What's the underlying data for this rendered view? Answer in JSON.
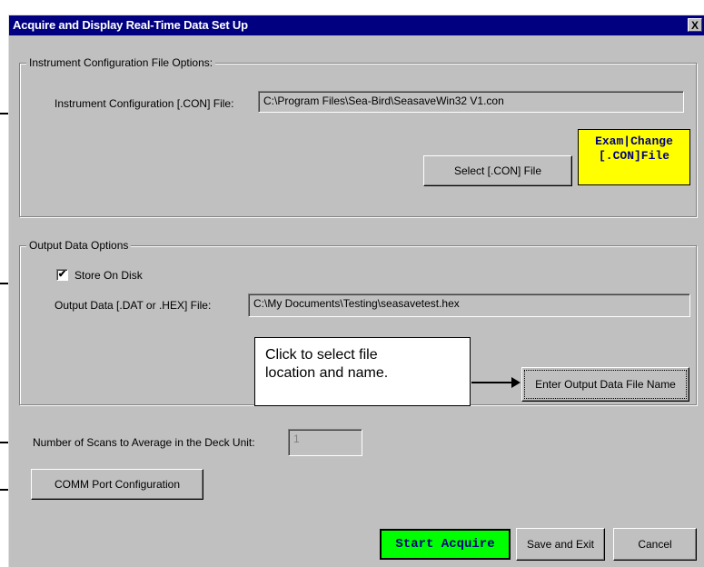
{
  "window": {
    "title": "Acquire and Display Real-Time Data Set Up",
    "close_glyph": "X"
  },
  "instrument_group": {
    "legend": "Instrument Configuration File Options:",
    "con_label": "Instrument Configuration [.CON] File:",
    "con_value": "C:\\Program Files\\Sea-Bird\\SeasaveWin32 V1.con",
    "select_button": "Select [.CON] File",
    "exam_line1": "Exam|Change",
    "exam_line2": "[.CON]File"
  },
  "output_group": {
    "legend": "Output Data Options",
    "store_on_disk_label": "Store On Disk",
    "store_on_disk_checked": true,
    "check_glyph": "✔",
    "output_label": "Output Data [.DAT or .HEX] File:",
    "output_value": "C:\\My Documents\\Testing\\seasavetest.hex",
    "callout_line1": "Click to select file",
    "callout_line2": "location and name.",
    "enter_button": "Enter Output Data File Name"
  },
  "scans": {
    "label": "Number of Scans to Average in the Deck Unit:",
    "value": "1"
  },
  "comm_button": "COMM Port Configuration",
  "footer": {
    "start_button": "Start Acquire",
    "save_button": "Save and Exit",
    "cancel_button": "Cancel"
  },
  "colors": {
    "title_bar": "#000080",
    "dialog_bg": "#c0c0c0",
    "exam_button_bg": "#ffff00",
    "start_button_bg": "#00ff00"
  }
}
